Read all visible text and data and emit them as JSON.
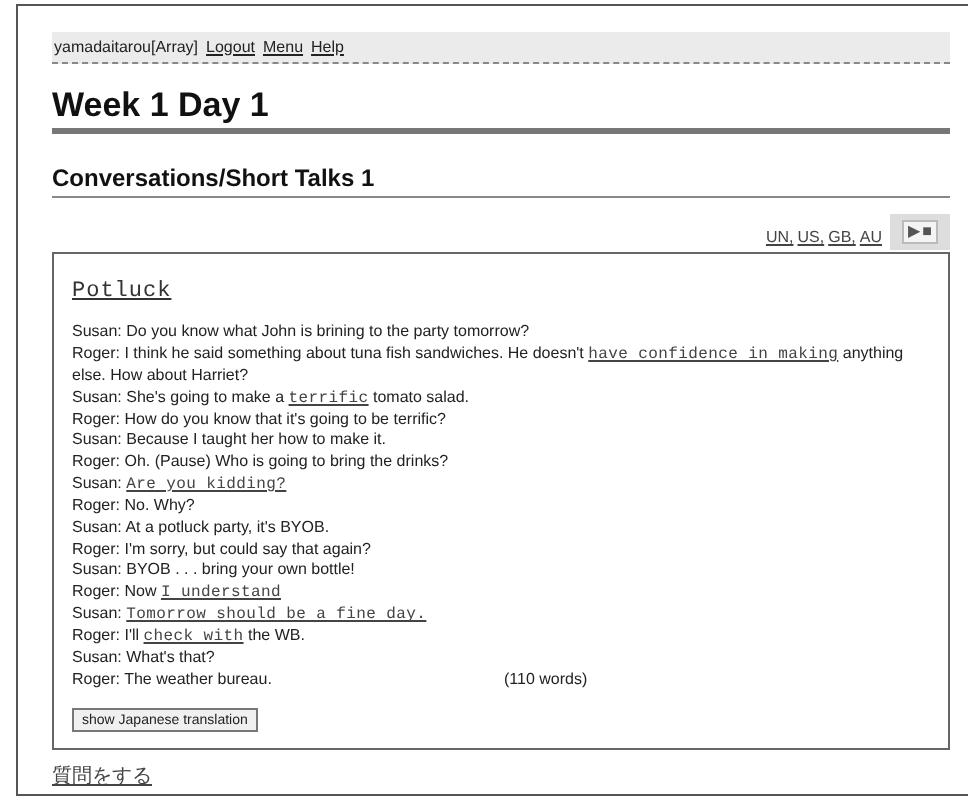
{
  "user_bar": {
    "user": "yamadaitarou[Array]",
    "links": [
      "Logout",
      "Menu",
      "Help"
    ]
  },
  "page_title": "Week 1 Day 1",
  "section_title": "Conversations/Short Talks 1",
  "accents": [
    "UN,",
    "US,",
    "GB,",
    "AU"
  ],
  "player": {
    "play_symbol": "▶",
    "stop_symbol": "■"
  },
  "passage": {
    "title": "Potluck",
    "lines": [
      [
        {
          "kind": "text",
          "text": "Susan: Do you know what John is brining to the party tomorrow?"
        }
      ],
      [
        {
          "kind": "text",
          "text": "Roger: I think he said something about tuna fish sandwiches. He doesn't "
        },
        {
          "kind": "link",
          "text": "have confidence in making"
        },
        {
          "kind": "text",
          "text": " anything else. How about Harriet?"
        }
      ],
      [
        {
          "kind": "text",
          "text": "Susan: She's going to make a "
        },
        {
          "kind": "link",
          "text": "terrific"
        },
        {
          "kind": "text",
          "text": " tomato salad."
        }
      ],
      [
        {
          "kind": "text",
          "text": "Roger: How do you know that it's going to be terrific?"
        }
      ],
      [
        {
          "kind": "text",
          "text": "Susan: Because I taught her how to make it."
        }
      ],
      [
        {
          "kind": "text",
          "text": "Roger: Oh. (Pause) Who is going to bring the drinks?"
        }
      ],
      [
        {
          "kind": "text",
          "text": "Susan: "
        },
        {
          "kind": "link",
          "text": "Are you kidding?"
        }
      ],
      [
        {
          "kind": "text",
          "text": "Roger: No. Why?"
        }
      ],
      [
        {
          "kind": "text",
          "text": "Susan: At a potluck party, it's BYOB."
        }
      ],
      [
        {
          "kind": "text",
          "text": "Roger: I'm sorry, but could say that again?"
        }
      ],
      [
        {
          "kind": "text",
          "text": "Susan: BYOB . . . bring your own bottle!"
        }
      ],
      [
        {
          "kind": "text",
          "text": "Roger: Now "
        },
        {
          "kind": "link",
          "text": "I understand"
        }
      ],
      [
        {
          "kind": "text",
          "text": "Susan: "
        },
        {
          "kind": "link",
          "text": "Tomorrow should be a fine day."
        }
      ],
      [
        {
          "kind": "text",
          "text": "Roger: I'll "
        },
        {
          "kind": "link",
          "text": "check with"
        },
        {
          "kind": "text",
          "text": " the WB."
        }
      ],
      [
        {
          "kind": "text",
          "text": "Susan: What's that?"
        }
      ],
      [
        {
          "kind": "text",
          "text": "Roger: The weather bureau."
        }
      ]
    ],
    "word_count": "(110 words)",
    "translation_button": "show Japanese translation"
  },
  "question_link": "質問をする"
}
